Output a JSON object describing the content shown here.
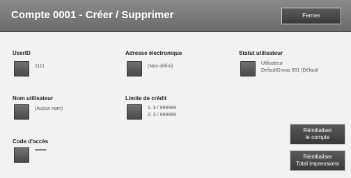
{
  "title": "Compte 0001 - Créer / Supprimer",
  "close_label": "Fermer",
  "fields": {
    "user_id": {
      "label": "UserID",
      "value": "1111"
    },
    "email": {
      "label": "Adresse électronique",
      "value": "(Non défini)"
    },
    "user_status": {
      "label": "Statut utilisateur",
      "value_line1": "Utilisateur",
      "value_line2": "DefaultGroup 001 (Défaut)"
    },
    "user_name": {
      "label": "Nom utilisateur",
      "value": "(Aucun nom)"
    },
    "credit_limit": {
      "label": "Limite de crédit",
      "value_line1": "1. 3 / 999999",
      "value_line2": "2. 3 / 999999"
    },
    "access_code": {
      "label": "Code d'accès",
      "value": "•••••••••••"
    }
  },
  "buttons": {
    "reset_account": {
      "line1": "Réinitialiser",
      "line2": "le compte"
    },
    "reset_prints": {
      "line1": "Réinitialiser",
      "line2": "Total impressions"
    }
  }
}
